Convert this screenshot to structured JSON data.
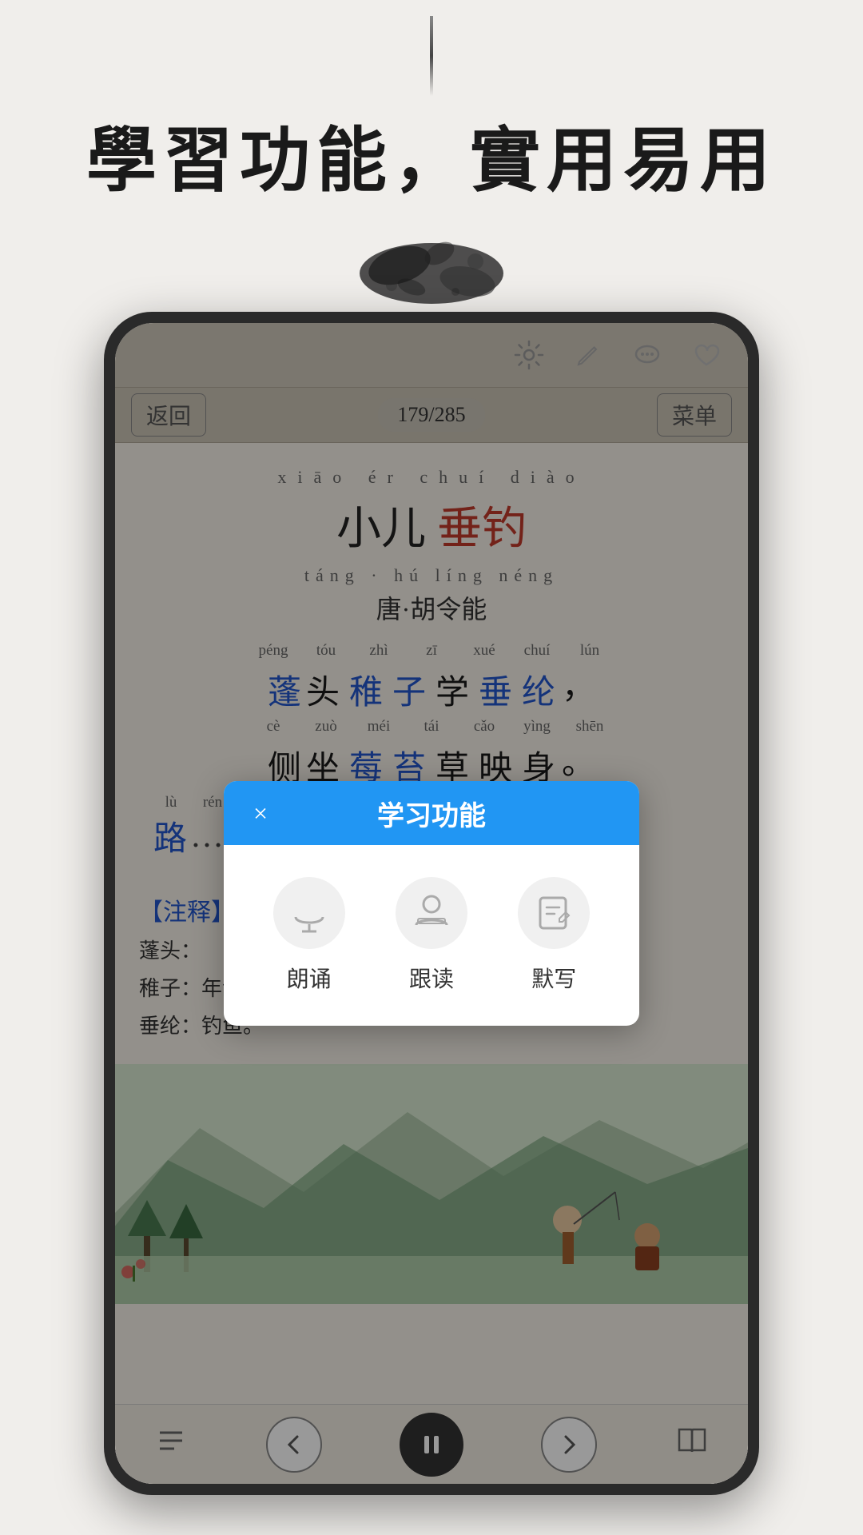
{
  "page": {
    "background_color": "#f0eeeb"
  },
  "header": {
    "main_title": "學習功能，實用易用"
  },
  "toolbar": {
    "icons": [
      "settings",
      "edit",
      "comment",
      "heart"
    ]
  },
  "nav": {
    "back_label": "返回",
    "page_indicator": "179/285",
    "menu_label": "菜单"
  },
  "poem": {
    "title_pinyin": "xiāo  ér  chuí  diào",
    "title_black": "小儿",
    "title_red": "垂钓",
    "author_pinyin": "táng · hú  líng  néng",
    "author": "唐·胡令能",
    "line1": {
      "chars": [
        {
          "pinyin": "péng",
          "text": "蓬",
          "color": "blue"
        },
        {
          "pinyin": "tóu",
          "text": "头",
          "color": "black"
        },
        {
          "pinyin": "zhì",
          "text": "稚",
          "color": "blue"
        },
        {
          "pinyin": "zī",
          "text": "子",
          "color": "blue"
        },
        {
          "pinyin": "xué",
          "text": "学",
          "color": "black"
        },
        {
          "pinyin": "chuí",
          "text": "垂",
          "color": "blue"
        },
        {
          "pinyin": "lún",
          "text": "纶",
          "color": "blue"
        }
      ],
      "punct": "，"
    },
    "line2": {
      "chars": [
        {
          "pinyin": "cè",
          "text": "侧",
          "color": "black"
        },
        {
          "pinyin": "zuò",
          "text": "坐",
          "color": "black"
        },
        {
          "pinyin": "méi",
          "text": "莓",
          "color": "blue"
        },
        {
          "pinyin": "tái",
          "text": "苔",
          "color": "blue"
        },
        {
          "pinyin": "cǎo",
          "text": "草",
          "color": "black"
        },
        {
          "pinyin": "yìng",
          "text": "映",
          "color": "black"
        },
        {
          "pinyin": "shēn",
          "text": "身",
          "color": "black"
        }
      ],
      "punct": "。"
    },
    "line3_partial": "路…",
    "line3_pinyin_row": "lù  rén  jiè  wèn  yáo  zhāo  shǒu"
  },
  "annotation": {
    "header": "【注释】",
    "items": [
      "蓬头：",
      "稚子：年龄小的、懵懂的孩子。",
      "垂纶：钓鱼。"
    ]
  },
  "modal": {
    "title": "学习功能",
    "close_label": "×",
    "items": [
      {
        "icon": "mic",
        "label": "朗诵"
      },
      {
        "icon": "read",
        "label": "跟读"
      },
      {
        "icon": "write",
        "label": "默写"
      }
    ]
  },
  "bottom_nav": {
    "prev_icon": "←",
    "play_icon": "⏸",
    "next_icon": "→",
    "book_icon": "📖"
  }
}
